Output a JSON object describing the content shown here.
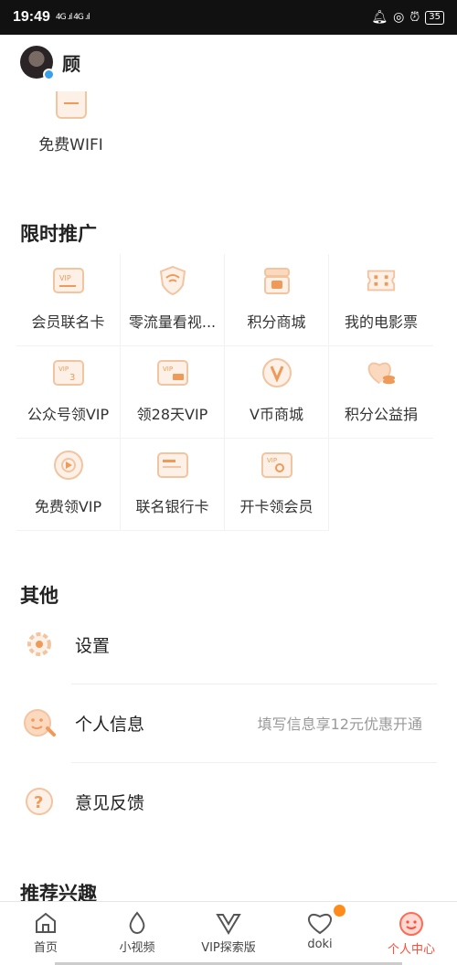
{
  "status_bar": {
    "time": "19:49",
    "signal": "4G .ıl 4G .ıl",
    "battery": "35"
  },
  "profile": {
    "name": "顾"
  },
  "top_item": {
    "label": "免费WIFI"
  },
  "promo": {
    "title": "限时推广",
    "items": [
      {
        "label": "会员联名卡",
        "icon": "vip-card-icon"
      },
      {
        "label": "零流量看视...",
        "icon": "shield-wifi-icon"
      },
      {
        "label": "积分商城",
        "icon": "points-store-icon"
      },
      {
        "label": "我的电影票",
        "icon": "ticket-icon"
      },
      {
        "label": "公众号领VIP",
        "icon": "vip-3-icon"
      },
      {
        "label": "领28天VIP",
        "icon": "vip-28-icon"
      },
      {
        "label": "V币商城",
        "icon": "vcoin-icon"
      },
      {
        "label": "积分公益捐",
        "icon": "heart-coin-icon"
      },
      {
        "label": "免费领VIP",
        "icon": "gift-icon"
      },
      {
        "label": "联名银行卡",
        "icon": "bank-card-icon"
      },
      {
        "label": "开卡领会员",
        "icon": "vip-open-card-icon"
      }
    ]
  },
  "other": {
    "title": "其他",
    "rows": [
      {
        "label": "设置",
        "hint": "",
        "icon": "gear-icon"
      },
      {
        "label": "个人信息",
        "hint": "填写信息享12元优惠开通",
        "icon": "face-edit-icon"
      },
      {
        "label": "意见反馈",
        "hint": "",
        "icon": "question-icon"
      }
    ]
  },
  "interest": {
    "title": "推荐兴趣"
  },
  "tabs": [
    {
      "label": "首页",
      "icon": "home-icon"
    },
    {
      "label": "小视频",
      "icon": "drop-icon"
    },
    {
      "label": "VIP探索版",
      "icon": "vip-crown-icon"
    },
    {
      "label": "doki",
      "icon": "doki-icon"
    },
    {
      "label": "个人中心",
      "icon": "smile-icon"
    }
  ],
  "colors": {
    "accent": "#f09a59",
    "accent_light": "#fdf1e7",
    "active_tab": "#ff4d3a"
  }
}
